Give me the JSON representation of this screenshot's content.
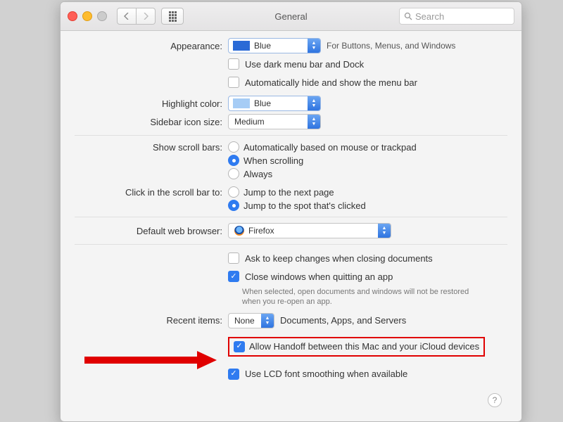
{
  "window": {
    "title": "General",
    "search_placeholder": "Search"
  },
  "appearance": {
    "label": "Appearance:",
    "value": "Blue",
    "note": "For Buttons, Menus, and Windows",
    "dark_menu": "Use dark menu bar and Dock",
    "auto_hide": "Automatically hide and show the menu bar"
  },
  "highlight": {
    "label": "Highlight color:",
    "value": "Blue"
  },
  "sidebar": {
    "label": "Sidebar icon size:",
    "value": "Medium"
  },
  "scrollbars": {
    "label": "Show scroll bars:",
    "auto": "Automatically based on mouse or trackpad",
    "when": "When scrolling",
    "always": "Always"
  },
  "click_scroll": {
    "label": "Click in the scroll bar to:",
    "page": "Jump to the next page",
    "spot": "Jump to the spot that's clicked"
  },
  "browser": {
    "label": "Default web browser:",
    "value": "Firefox"
  },
  "docs": {
    "ask": "Ask to keep changes when closing documents",
    "close": "Close windows when quitting an app",
    "note": "When selected, open documents and windows will not be restored when you re-open an app."
  },
  "recent": {
    "label": "Recent items:",
    "value": "None",
    "suffix": "Documents, Apps, and Servers"
  },
  "handoff": {
    "text": "Allow Handoff between this Mac and your iCloud devices"
  },
  "lcd": {
    "text": "Use LCD font smoothing when available"
  }
}
